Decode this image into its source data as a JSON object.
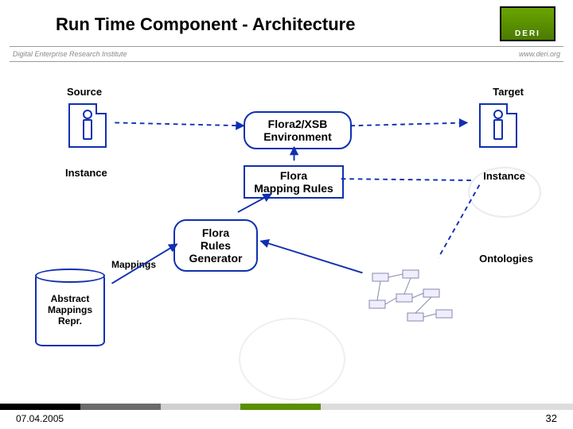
{
  "title": "Run Time Component - Architecture",
  "logo_text": "DERI",
  "subbar": {
    "left": "Digital Enterprise Research Institute",
    "right": "www.deri.org"
  },
  "diagram": {
    "source_label": "Source",
    "target_label": "Target",
    "instance_label_left": "Instance",
    "instance_label_right": "Instance",
    "flora_env": "Flora2/XSB\nEnvironment",
    "flora_rules": "Flora\nMapping Rules",
    "flora_gen": "Flora\nRules\nGenerator",
    "mappings_label": "Mappings",
    "ontologies_label": "Ontologies",
    "cylinder": "Abstract\nMappings\nRepr."
  },
  "footer": {
    "date": "07.04.2005",
    "page": "32"
  },
  "colors": {
    "accent": "#1030b0",
    "bar_segments": [
      "#000000",
      "#6b6b6b",
      "#d0d0d0",
      "#5a8f00",
      "#dddddd"
    ]
  }
}
